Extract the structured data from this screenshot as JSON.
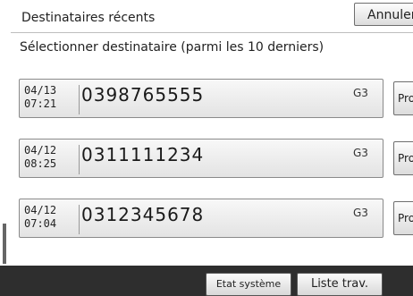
{
  "header": {
    "title": "Destinataires récents",
    "cancel_label": "Annuler"
  },
  "subtitle": "Sélectionner destinataire (parmi les 10 derniers)",
  "entries": [
    {
      "date": "04/13",
      "time": "07:21",
      "number": "0398765555",
      "mode": "G3",
      "prog_label": "Prog."
    },
    {
      "date": "04/12",
      "time": "08:25",
      "number": "0311111234",
      "mode": "G3",
      "prog_label": "Prog."
    },
    {
      "date": "04/12",
      "time": "07:04",
      "number": "0312345678",
      "mode": "G3",
      "prog_label": "Prog."
    }
  ],
  "footer": {
    "system_status_label": "Etat système",
    "job_list_label": "Liste trav."
  }
}
